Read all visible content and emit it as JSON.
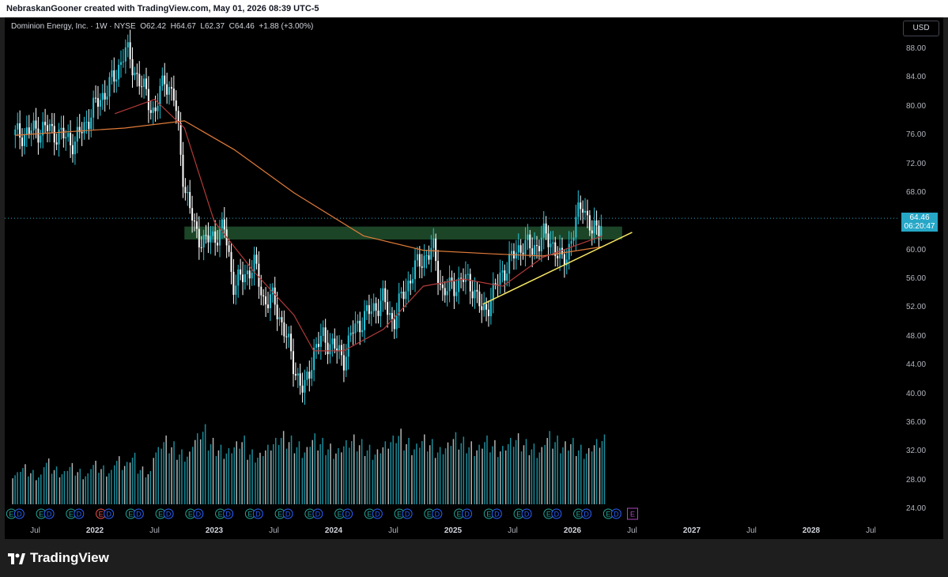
{
  "header": {
    "attribution": "NebraskanGooner created with TradingView.com, May 01, 2026 08:39 UTC-5"
  },
  "legend": {
    "symbol": "Dominion Energy, Inc. · 1W · NYSE",
    "open_label": "O",
    "open": "62.42",
    "high_label": "H",
    "high": "64.67",
    "low_label": "L",
    "low": "62.37",
    "close_label": "C",
    "close": "64.46",
    "change": "+1.88 (+3.00%)"
  },
  "currency_button": "USD",
  "last_price": {
    "value": "64.46",
    "countdown": "06:20:47"
  },
  "footer": {
    "brand": "TradingView"
  },
  "colors": {
    "up": "#26c6da",
    "down": "#ffffff",
    "support_zone": "#1f4d2b",
    "trendline": "#f5e663",
    "ma_long": "#e07b39",
    "ma_short": "#b33a3a",
    "earnings_e": "#26a69a",
    "earnings_red": "#ef5350",
    "dividend_d": "#2962ff",
    "future_e": "#ab47bc",
    "price_tag": "#26a7c7"
  },
  "chart_data": {
    "type": "candlestick",
    "timeframe": "1W",
    "y_ticks": [
      "88.00",
      "84.00",
      "80.00",
      "76.00",
      "72.00",
      "68.00",
      "64.00",
      "60.00",
      "56.00",
      "52.00",
      "48.00",
      "44.00",
      "40.00",
      "36.00",
      "32.00",
      "28.00",
      "24.00"
    ],
    "x_ticks": [
      {
        "label": "Jul",
        "date": "2021-07",
        "bold": false
      },
      {
        "label": "2022",
        "date": "2022-01",
        "bold": true
      },
      {
        "label": "Jul",
        "date": "2022-07",
        "bold": false
      },
      {
        "label": "2023",
        "date": "2023-01",
        "bold": true
      },
      {
        "label": "Jul",
        "date": "2023-07",
        "bold": false
      },
      {
        "label": "2024",
        "date": "2024-01",
        "bold": true
      },
      {
        "label": "Jul",
        "date": "2024-07",
        "bold": false
      },
      {
        "label": "2025",
        "date": "2025-01",
        "bold": true
      },
      {
        "label": "Jul",
        "date": "2025-07",
        "bold": false
      },
      {
        "label": "2026",
        "date": "2026-01",
        "bold": true
      },
      {
        "label": "Jul",
        "date": "2026-07",
        "bold": false
      },
      {
        "label": "2027",
        "date": "2027-01",
        "bold": true
      },
      {
        "label": "Jul",
        "date": "2027-07",
        "bold": false
      },
      {
        "label": "2028",
        "date": "2028-01",
        "bold": true
      },
      {
        "label": "Jul",
        "date": "2028-07",
        "bold": false
      }
    ],
    "price_path": [
      {
        "date": "2021-05",
        "price": 76
      },
      {
        "date": "2021-08",
        "price": 77
      },
      {
        "date": "2021-11",
        "price": 75
      },
      {
        "date": "2022-01",
        "price": 80
      },
      {
        "date": "2022-03",
        "price": 84
      },
      {
        "date": "2022-04",
        "price": 88
      },
      {
        "date": "2022-06",
        "price": 82
      },
      {
        "date": "2022-07",
        "price": 79
      },
      {
        "date": "2022-08",
        "price": 84
      },
      {
        "date": "2022-09",
        "price": 81
      },
      {
        "date": "2022-10",
        "price": 69
      },
      {
        "date": "2022-11",
        "price": 63
      },
      {
        "date": "2022-12",
        "price": 61
      },
      {
        "date": "2023-02",
        "price": 63
      },
      {
        "date": "2023-03",
        "price": 55
      },
      {
        "date": "2023-05",
        "price": 58
      },
      {
        "date": "2023-06",
        "price": 53
      },
      {
        "date": "2023-07",
        "price": 53
      },
      {
        "date": "2023-08",
        "price": 49
      },
      {
        "date": "2023-09",
        "price": 44
      },
      {
        "date": "2023-10",
        "price": 40
      },
      {
        "date": "2023-11",
        "price": 46
      },
      {
        "date": "2023-12",
        "price": 48
      },
      {
        "date": "2024-02",
        "price": 45
      },
      {
        "date": "2024-03",
        "price": 49
      },
      {
        "date": "2024-05",
        "price": 52
      },
      {
        "date": "2024-06",
        "price": 53
      },
      {
        "date": "2024-07",
        "price": 50
      },
      {
        "date": "2024-08",
        "price": 54
      },
      {
        "date": "2024-09",
        "price": 57
      },
      {
        "date": "2024-10",
        "price": 59
      },
      {
        "date": "2024-11",
        "price": 60
      },
      {
        "date": "2024-12",
        "price": 54
      },
      {
        "date": "2025-02",
        "price": 56
      },
      {
        "date": "2025-03",
        "price": 55
      },
      {
        "date": "2025-04",
        "price": 51
      },
      {
        "date": "2025-05",
        "price": 54
      },
      {
        "date": "2025-06",
        "price": 57
      },
      {
        "date": "2025-07",
        "price": 59
      },
      {
        "date": "2025-08",
        "price": 61
      },
      {
        "date": "2025-09",
        "price": 60
      },
      {
        "date": "2025-10",
        "price": 62
      },
      {
        "date": "2025-11",
        "price": 61
      },
      {
        "date": "2025-12",
        "price": 58
      },
      {
        "date": "2026-01",
        "price": 62
      },
      {
        "date": "2026-02",
        "price": 67
      },
      {
        "date": "2026-03",
        "price": 62
      },
      {
        "date": "2026-04",
        "price": 64.46
      }
    ],
    "ma_long": [
      {
        "date": "2021-05",
        "price": 76
      },
      {
        "date": "2022-04",
        "price": 77
      },
      {
        "date": "2022-10",
        "price": 78
      },
      {
        "date": "2023-03",
        "price": 74
      },
      {
        "date": "2023-09",
        "price": 68
      },
      {
        "date": "2024-04",
        "price": 62
      },
      {
        "date": "2024-10",
        "price": 60
      },
      {
        "date": "2025-05",
        "price": 59.5
      },
      {
        "date": "2025-10",
        "price": 59.2
      },
      {
        "date": "2026-04",
        "price": 60.5
      }
    ],
    "ma_short": [
      {
        "date": "2022-03",
        "price": 79
      },
      {
        "date": "2022-07",
        "price": 81
      },
      {
        "date": "2022-10",
        "price": 77
      },
      {
        "date": "2023-01",
        "price": 64
      },
      {
        "date": "2023-05",
        "price": 57
      },
      {
        "date": "2023-09",
        "price": 51
      },
      {
        "date": "2023-11",
        "price": 46
      },
      {
        "date": "2024-02",
        "price": 46
      },
      {
        "date": "2024-06",
        "price": 49
      },
      {
        "date": "2024-10",
        "price": 55
      },
      {
        "date": "2025-02",
        "price": 56
      },
      {
        "date": "2025-06",
        "price": 55
      },
      {
        "date": "2025-10",
        "price": 59
      },
      {
        "date": "2026-04",
        "price": 62
      }
    ],
    "support_zone": {
      "from": "2022-10",
      "to": "2026-06",
      "low": 61.5,
      "high": 63.3
    },
    "trendline": {
      "start": {
        "date": "2025-04",
        "price": 52.5
      },
      "end": {
        "date": "2026-07",
        "price": 62.5
      }
    },
    "volume_scale_max": 100,
    "volume": [
      28,
      35,
      30,
      26,
      40,
      33,
      29,
      36,
      31,
      27,
      38,
      34,
      30,
      42,
      37,
      45,
      33,
      29,
      50,
      60,
      55,
      48,
      46,
      62,
      70,
      58,
      52,
      49,
      55,
      60,
      48,
      45,
      52,
      58,
      64,
      60,
      55,
      50,
      62,
      58,
      53,
      49,
      56,
      61,
      57,
      52,
      48,
      55,
      60,
      66,
      58,
      53,
      61,
      57,
      50,
      54,
      63,
      59,
      55,
      52,
      60,
      56,
      51,
      58,
      62,
      57,
      53,
      50,
      64,
      60,
      55,
      58,
      52,
      49,
      57,
      61
    ],
    "earnings_markers": [
      {
        "date": "2021-05",
        "text": "E"
      },
      {
        "date": "2021-08",
        "text": "E"
      },
      {
        "date": "2021-11",
        "text": "E"
      },
      {
        "date": "2022-02",
        "text": "E"
      },
      {
        "date": "2022-05",
        "text": "E"
      },
      {
        "date": "2022-08",
        "text": "E"
      },
      {
        "date": "2022-11",
        "text": "E"
      },
      {
        "date": "2023-02",
        "text": "E"
      },
      {
        "date": "2023-05",
        "text": "E"
      },
      {
        "date": "2023-08",
        "text": "E"
      },
      {
        "date": "2023-11",
        "text": "E"
      },
      {
        "date": "2024-02",
        "text": "E"
      },
      {
        "date": "2024-05",
        "text": "E"
      },
      {
        "date": "2024-08",
        "text": "E"
      },
      {
        "date": "2024-11",
        "text": "E"
      },
      {
        "date": "2025-02",
        "text": "E"
      },
      {
        "date": "2025-05",
        "text": "E"
      },
      {
        "date": "2025-08",
        "text": "E"
      },
      {
        "date": "2025-11",
        "text": "E"
      },
      {
        "date": "2026-02",
        "text": "E"
      },
      {
        "date": "2026-05",
        "text": "E"
      }
    ],
    "upcoming_earnings": {
      "date": "2026-07",
      "text": "E"
    },
    "dividend_markers_text": "D"
  }
}
